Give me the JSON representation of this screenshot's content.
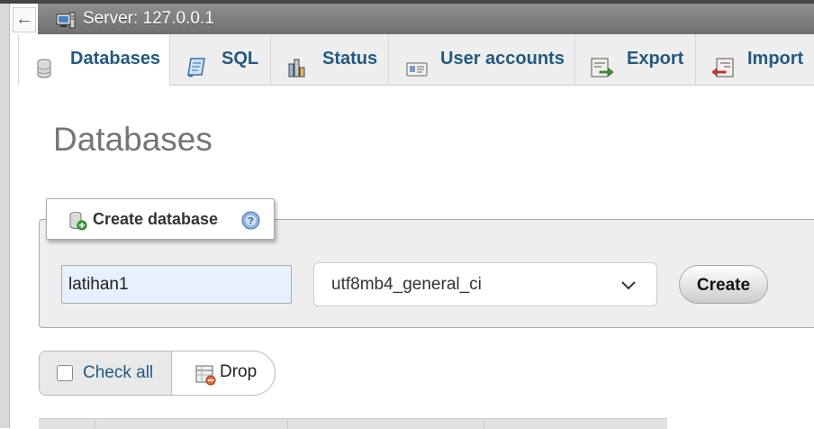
{
  "nav": {
    "back_glyph": "←",
    "server_label": "Server: 127.0.0.1",
    "server_icon": "server-icon"
  },
  "tabs": [
    {
      "label": "Databases",
      "icon": "database-icon",
      "active": true
    },
    {
      "label": "SQL",
      "icon": "sql-icon",
      "active": false
    },
    {
      "label": "Status",
      "icon": "status-icon",
      "active": false
    },
    {
      "label": "User accounts",
      "icon": "user-accounts-icon",
      "active": false
    },
    {
      "label": "Export",
      "icon": "export-icon",
      "active": false
    },
    {
      "label": "Import",
      "icon": "import-icon",
      "active": false
    }
  ],
  "page": {
    "title": "Databases"
  },
  "create_db": {
    "legend": "Create database",
    "name_value": "latihan1",
    "collation_value": "utf8mb4_general_ci",
    "create_label": "Create"
  },
  "actions": {
    "check_all_label": "Check all",
    "drop_label": "Drop"
  },
  "colors": {
    "tab_text": "#235a81",
    "server_bar": "#7f7f7f",
    "input_autofill": "#e8f0fe"
  }
}
